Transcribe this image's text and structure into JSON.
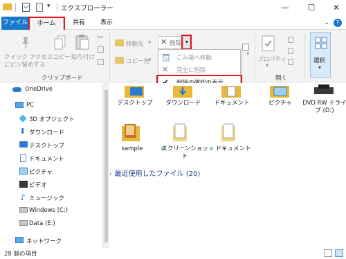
{
  "window": {
    "title": "エクスプローラー",
    "minimize": "—",
    "maximize": "☐",
    "close": "✕"
  },
  "tabs": {
    "file": "ファイル",
    "home": "ホーム",
    "share": "共有",
    "view": "表示"
  },
  "ribbon": {
    "pin_label_1": "クイック アクセス",
    "pin_label_2": "にピン留めする",
    "copy_label": "コピー",
    "paste_label": "貼り付け",
    "move_to": "移動先",
    "copy_to": "コピー先",
    "delete": "削除",
    "properties": "プロパティ",
    "select": "選択",
    "group_clipboard": "クリップボード",
    "group_organize": "整",
    "group_open": "開く"
  },
  "delete_menu": {
    "items": [
      {
        "label": "ごみ箱へ移動"
      },
      {
        "label": "完全に削除"
      },
      {
        "label": "削除の確認の表示"
      }
    ]
  },
  "nav": {
    "items": [
      {
        "label": "OneDrive"
      },
      {
        "label": "PC"
      },
      {
        "label": "3D オブジェクト"
      },
      {
        "label": "ダウンロード"
      },
      {
        "label": "デスクトップ"
      },
      {
        "label": "ドキュメント"
      },
      {
        "label": "ピクチャ"
      },
      {
        "label": "ビデオ"
      },
      {
        "label": "ミュージック"
      },
      {
        "label": "Windows (C:)"
      },
      {
        "label": "Data (E:)"
      },
      {
        "label": "ネットワーク"
      }
    ]
  },
  "content": {
    "row1": [
      {
        "label": "デスクトップ"
      },
      {
        "label": "ダウンロード"
      },
      {
        "label": "ドキュメント"
      },
      {
        "label": "ピクチャ"
      },
      {
        "label": "DVD RW ドライブ (D:)"
      }
    ],
    "row2": [
      {
        "label": "sample"
      },
      {
        "label": "スクリーンショット"
      },
      {
        "label": "ドキュメント"
      }
    ],
    "recent": "最近使用したファイル (20)"
  },
  "status": {
    "count": "28 個の項目"
  },
  "colors": {
    "accent": "#1979ca",
    "highlight": "#e0141e"
  }
}
